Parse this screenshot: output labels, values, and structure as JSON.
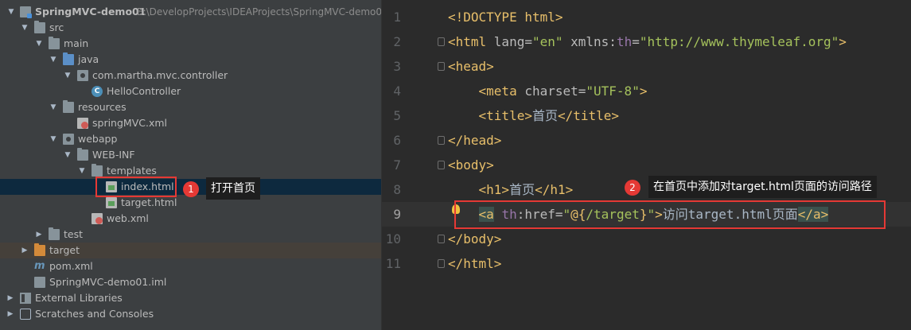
{
  "project": {
    "name": "SpringMVC-demo01",
    "path": "E:\\DevelopProjects\\IDEAProjects\\SpringMVC-demo0"
  },
  "tree": {
    "src": "src",
    "main": "main",
    "java": "java",
    "package": "com.martha.mvc.controller",
    "controller": "HelloController",
    "resources": "resources",
    "springmvc_xml": "springMVC.xml",
    "webapp": "webapp",
    "webinf": "WEB-INF",
    "templates": "templates",
    "index_html": "index.html",
    "target_html": "target.html",
    "web_xml": "web.xml",
    "test": "test",
    "target": "target",
    "pom": "pom.xml",
    "iml": "SpringMVC-demo01.iml",
    "external_libraries": "External Libraries",
    "scratches": "Scratches and Consoles"
  },
  "annotations": {
    "badge1": "1",
    "callout1": "打开首页",
    "badge2": "2",
    "callout2": "在首页中添加对target.html页面的访问路径"
  },
  "editor": {
    "line_numbers": [
      "1",
      "2",
      "3",
      "4",
      "5",
      "6",
      "7",
      "8",
      "9",
      "10",
      "11"
    ],
    "active_line": 9,
    "lines": [
      [
        {
          "c": "tag",
          "t": "<!DOCTYPE "
        },
        {
          "c": "tag",
          "t": "html"
        },
        {
          "c": "tag",
          "t": ">"
        }
      ],
      [
        {
          "c": "tag",
          "t": "<html "
        },
        {
          "c": "attr",
          "t": "lang="
        },
        {
          "c": "str",
          "t": "\"en\""
        },
        {
          "c": "attr",
          "t": " xmlns:"
        },
        {
          "c": "ns",
          "t": "th"
        },
        {
          "c": "attr",
          "t": "="
        },
        {
          "c": "str",
          "t": "\"http://www.thymeleaf.org\""
        },
        {
          "c": "tag",
          "t": ">"
        }
      ],
      [
        {
          "c": "tag",
          "t": "<head>"
        }
      ],
      [
        {
          "c": "txt",
          "t": "    "
        },
        {
          "c": "tag",
          "t": "<meta "
        },
        {
          "c": "attr",
          "t": "charset="
        },
        {
          "c": "str",
          "t": "\"UTF-8\""
        },
        {
          "c": "tag",
          "t": ">"
        }
      ],
      [
        {
          "c": "txt",
          "t": "    "
        },
        {
          "c": "tag",
          "t": "<title>"
        },
        {
          "c": "txt",
          "t": "首页"
        },
        {
          "c": "tag",
          "t": "</title>"
        }
      ],
      [
        {
          "c": "tag",
          "t": "</head>"
        }
      ],
      [
        {
          "c": "tag",
          "t": "<body>"
        }
      ],
      [
        {
          "c": "txt",
          "t": "    "
        },
        {
          "c": "tag",
          "t": "<h1>"
        },
        {
          "c": "txt",
          "t": "首页"
        },
        {
          "c": "tag",
          "t": "</h1>"
        }
      ],
      [
        {
          "c": "txt",
          "t": "    "
        },
        {
          "c": "tag tag-hl",
          "t": "<a"
        },
        {
          "c": "attr",
          "t": " "
        },
        {
          "c": "ns",
          "t": "th"
        },
        {
          "c": "attr",
          "t": ":href="
        },
        {
          "c": "str",
          "t": "\""
        },
        {
          "c": "tag",
          "t": "@{"
        },
        {
          "c": "str",
          "t": "/target"
        },
        {
          "c": "tag",
          "t": "}"
        },
        {
          "c": "str",
          "t": "\""
        },
        {
          "c": "tag",
          "t": ">"
        },
        {
          "c": "txt",
          "t": "访问target.html页面"
        },
        {
          "c": "tag tag-hl",
          "t": "</a>"
        }
      ],
      [
        {
          "c": "tag",
          "t": "</body>"
        }
      ],
      [
        {
          "c": "tag",
          "t": "</html>"
        }
      ]
    ]
  },
  "colors": {
    "annotation_red": "#e53935",
    "tag": "#e8bf6a",
    "string": "#a5c25c",
    "namespace": "#9876aa"
  }
}
